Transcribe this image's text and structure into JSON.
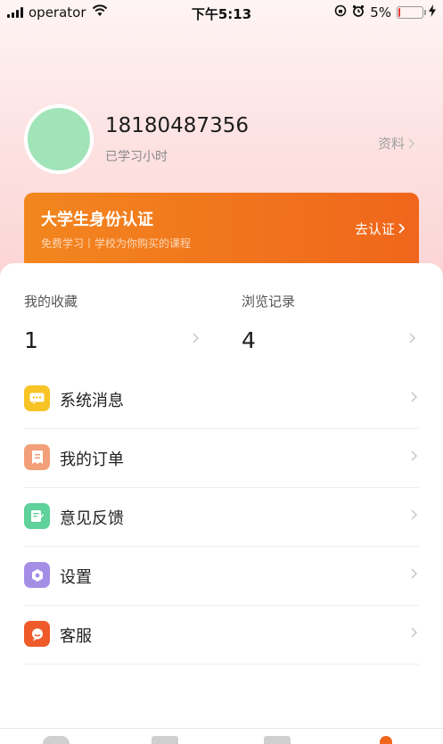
{
  "status_bar": {
    "carrier": "operator",
    "time": "下午5:13",
    "battery": "5%",
    "battery_level": 0.05
  },
  "profile": {
    "phone": "18180487356",
    "learned": "已学习小时",
    "profile_link": "资料"
  },
  "banner": {
    "title": "大学生身份认证",
    "subtitle": "免费学习丨学校为你购买的课程",
    "cta": "去认证"
  },
  "stats": [
    {
      "label": "我的收藏",
      "value": "1"
    },
    {
      "label": "浏览记录",
      "value": "4"
    }
  ],
  "menu": [
    {
      "label": "系统消息",
      "icon": "message-icon",
      "color": "#f7c325"
    },
    {
      "label": "我的订单",
      "icon": "order-icon",
      "color": "#f3a07a"
    },
    {
      "label": "意见反馈",
      "icon": "feedback-icon",
      "color": "#5fd19a"
    },
    {
      "label": "设置",
      "icon": "settings-icon",
      "color": "#a58ee6"
    },
    {
      "label": "客服",
      "icon": "customer-service-icon",
      "color": "#ee5a2a"
    }
  ],
  "colors": {
    "accent": "#f0661c",
    "avatar": "#a0e4b8"
  }
}
